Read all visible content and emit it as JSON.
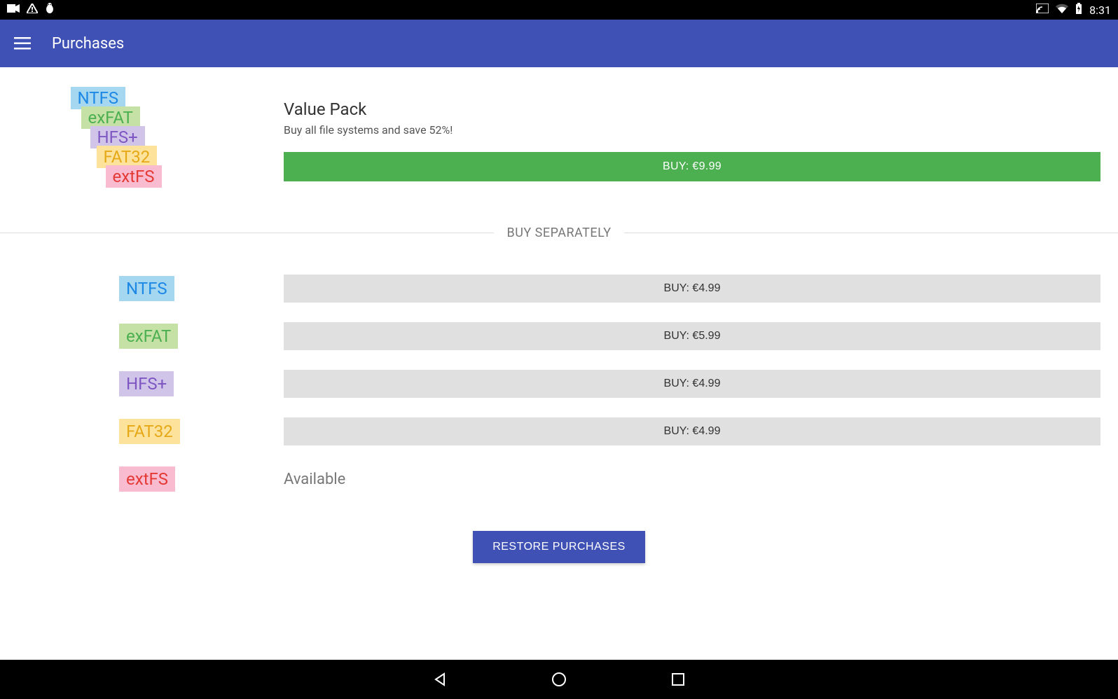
{
  "status": {
    "time": "8:31"
  },
  "appbar": {
    "title": "Purchases"
  },
  "value_pack": {
    "title": "Value Pack",
    "subtitle": "Buy all file systems and save 52%!",
    "buy_label": "BUY: €9.99",
    "chips": {
      "ntfs": "NTFS",
      "exfat": "exFAT",
      "hfs": "HFS+",
      "fat32": "FAT32",
      "extfs": "extFS"
    }
  },
  "separator_label": "BUY SEPARATELY",
  "items": {
    "ntfs": {
      "label": "NTFS",
      "buy": "BUY: €4.99"
    },
    "exfat": {
      "label": "exFAT",
      "buy": "BUY: €5.99"
    },
    "hfs": {
      "label": "HFS+",
      "buy": "BUY: €4.99"
    },
    "fat32": {
      "label": "FAT32",
      "buy": "BUY: €4.99"
    },
    "extfs": {
      "label": "extFS",
      "status": "Available"
    }
  },
  "restore_label": "RESTORE PURCHASES"
}
